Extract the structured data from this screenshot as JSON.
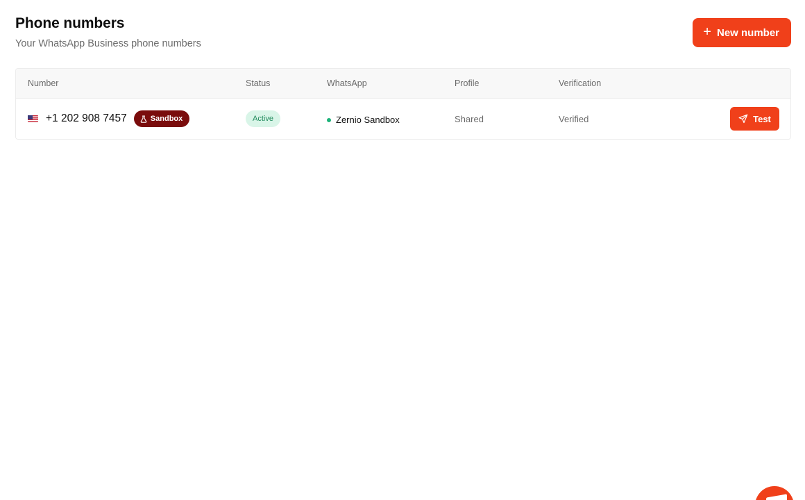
{
  "header": {
    "title": "Phone numbers",
    "subtitle": "Your WhatsApp Business phone numbers",
    "new_button_label": "New number"
  },
  "table": {
    "columns": [
      "Number",
      "Status",
      "WhatsApp",
      "Profile",
      "Verification"
    ],
    "rows": [
      {
        "flag": "us-flag-icon",
        "number": "+1 202 908 7457",
        "badge": "Sandbox",
        "status": "Active",
        "whatsapp": "Zernio Sandbox",
        "profile": "Shared",
        "verification": "Verified",
        "action_label": "Test"
      }
    ]
  },
  "colors": {
    "accent": "#f0401a",
    "sandbox_badge": "#7a0c0c",
    "status_bg": "#d9f5e8",
    "status_text": "#1f8a5b",
    "online_dot": "#1db37a"
  },
  "icons": {
    "new_button": "plus-icon",
    "sandbox_badge": "flask-icon",
    "test_button": "send-icon",
    "floating": "chat-fab-icon"
  }
}
